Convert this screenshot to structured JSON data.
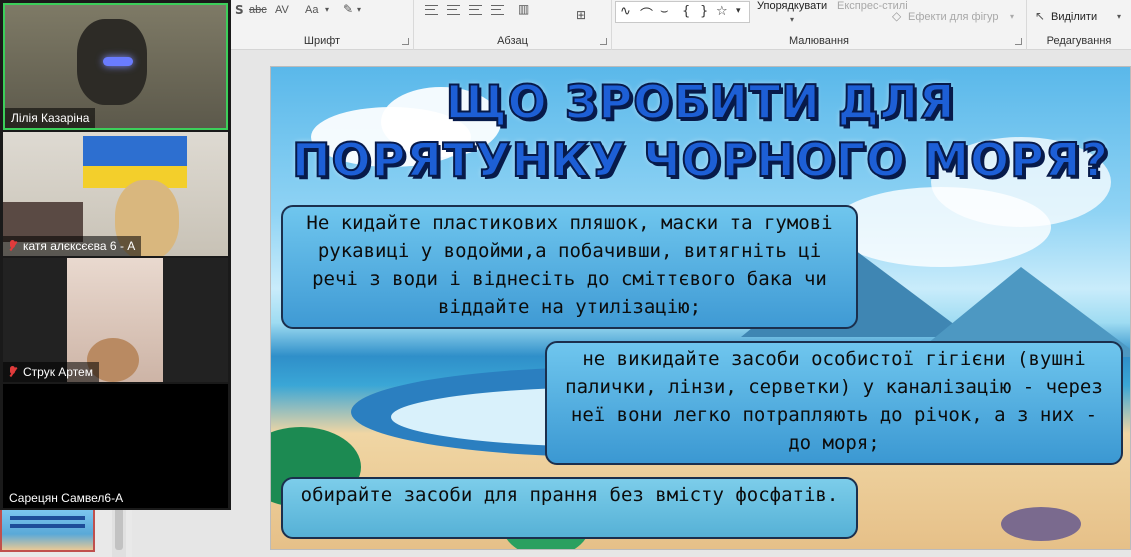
{
  "ribbon": {
    "groups": {
      "font": "Шрифт",
      "paragraph": "Абзац",
      "drawing": "Малювання",
      "editing": "Редагування"
    },
    "buttons": {
      "arrange": "Упорядкувати",
      "quick_styles": "Експрес-стилі",
      "shape_effects": "Ефекти для фігур",
      "select": "Виділити"
    },
    "font_icons": [
      "abc",
      "AV",
      "Aa"
    ]
  },
  "slide": {
    "title_line1": "ЩО ЗРОБИТИ ДЛЯ",
    "title_line2": "ПОРЯТУНКУ ЧОРНОГО МОРЯ?",
    "box1": "Не кидайте пластикових пляшок, маски та гумові рукавиці у водойми,а побачивши, витягніть ці речі з води і віднесіть до сміттєвого бака чи віддайте на утилізацію;",
    "box2": "не викидайте засоби особистої гігієни (вушні палички, лінзи, серветки) у каналізацію - через неї вони легко потрапляють до річок, а з них - до моря;",
    "box3": "обирайте засоби для прання без вмісту фосфатів."
  },
  "participants": [
    {
      "name": "Лілія Казаріна",
      "muted": false,
      "active_speaker": true
    },
    {
      "name": "катя алєксєєва 6 - А",
      "muted": true
    },
    {
      "name": "Струк Артем",
      "muted": true
    },
    {
      "name": "Сарецян Самвел6-А",
      "muted": false
    }
  ],
  "colors": {
    "active_speaker_border": "#3ccf5a",
    "muted_icon": "#e03b3b",
    "title_fill": "#1d5fd6"
  }
}
